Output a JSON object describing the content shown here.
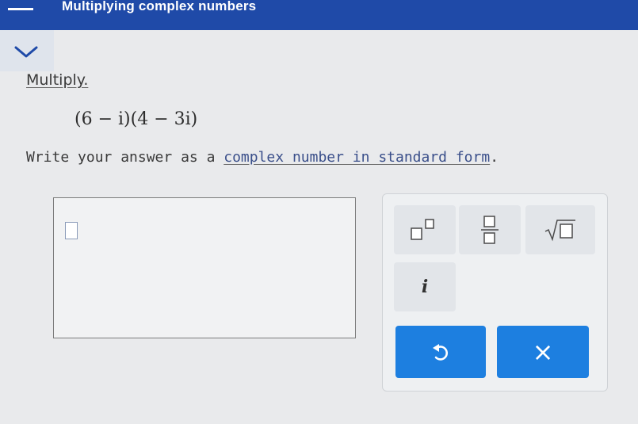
{
  "header": {
    "title": "Multiplying complex numbers",
    "background_color": "#1f4aa8"
  },
  "collapse_toggle": {
    "icon": "chevron-down-icon"
  },
  "problem": {
    "instruction": "Multiply.",
    "expression": "(6 − i)(4 − 3i)",
    "prompt_prefix": "Write your answer as a ",
    "prompt_link": "complex number in standard form",
    "prompt_suffix": "."
  },
  "answer": {
    "value": ""
  },
  "keypad": {
    "keys": [
      {
        "name": "superscript",
        "icon": "superscript-icon"
      },
      {
        "name": "fraction",
        "icon": "fraction-icon"
      },
      {
        "name": "square-root",
        "icon": "square-root-icon"
      },
      {
        "name": "imaginary-unit",
        "label": "i"
      }
    ],
    "undo_icon": "undo-icon",
    "clear_label": "×",
    "button_color": "#1d7fe0"
  }
}
